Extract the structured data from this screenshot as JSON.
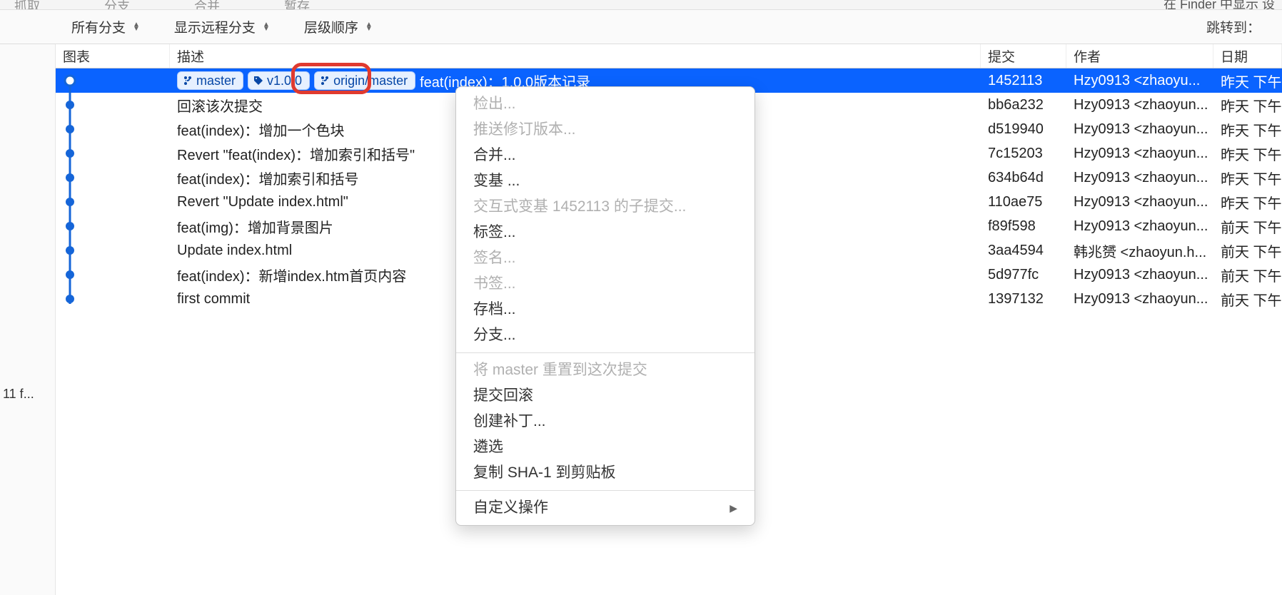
{
  "top_toolbar": {
    "items": [
      "抓取",
      "分支",
      "合并",
      "暂存"
    ],
    "right": "在 Finder 中显示   设"
  },
  "filter_bar": {
    "all_branches": "所有分支",
    "show_remote": "显示远程分支",
    "order": "层级顺序",
    "jump_to": "跳转到："
  },
  "columns": {
    "graph": "图表",
    "description": "描述",
    "commit": "提交",
    "author": "作者",
    "date": "日期"
  },
  "pills": {
    "master": "master",
    "tag": "v1.0.0",
    "origin_master": "origin/master"
  },
  "rows": [
    {
      "desc": "feat(index)：1.0.0版本记录",
      "commit": "1452113",
      "author": "Hzy0913 <zhaoyu...",
      "date": "昨天 下午",
      "selected": true,
      "has_pills": true
    },
    {
      "desc": "回滚该次提交",
      "commit": "bb6a232",
      "author": "Hzy0913 <zhaoyun...",
      "date": "昨天 下午"
    },
    {
      "desc": "feat(index)：增加一个色块",
      "commit": "d519940",
      "author": "Hzy0913 <zhaoyun...",
      "date": "昨天 下午"
    },
    {
      "desc": "Revert \"feat(index)：增加索引和括号\"",
      "commit": "7c15203",
      "author": "Hzy0913 <zhaoyun...",
      "date": "昨天 下午"
    },
    {
      "desc": "feat(index)：增加索引和括号",
      "commit": "634b64d",
      "author": "Hzy0913 <zhaoyun...",
      "date": "昨天 下午"
    },
    {
      "desc": "Revert \"Update index.html\"",
      "commit": "110ae75",
      "author": "Hzy0913 <zhaoyun...",
      "date": "昨天 下午"
    },
    {
      "desc": "feat(img)：增加背景图片",
      "commit": "f89f598",
      "author": "Hzy0913 <zhaoyun...",
      "date": "前天 下午"
    },
    {
      "desc": "Update index.html",
      "commit": "3aa4594",
      "author": "韩兆赟 <zhaoyun.h...",
      "date": "前天 下午"
    },
    {
      "desc": "feat(index)：新增index.htm首页内容",
      "commit": "5d977fc",
      "author": "Hzy0913 <zhaoyun...",
      "date": "前天 下午"
    },
    {
      "desc": "first commit",
      "commit": "1397132",
      "author": "Hzy0913 <zhaoyun...",
      "date": "前天 下午"
    }
  ],
  "sidebar": {
    "item": "11 f..."
  },
  "context_menu": {
    "items": [
      {
        "label": "检出...",
        "disabled": true
      },
      {
        "label": "推送修订版本...",
        "disabled": true
      },
      {
        "label": "合并...",
        "disabled": false
      },
      {
        "label": "变基 ...",
        "disabled": false
      },
      {
        "label": "交互式变基 1452113 的子提交...",
        "disabled": true
      },
      {
        "label": "标签...",
        "disabled": false,
        "highlight": true
      },
      {
        "label": "签名...",
        "disabled": true
      },
      {
        "label": "书签...",
        "disabled": true
      },
      {
        "label": "存档...",
        "disabled": false
      },
      {
        "label": "分支...",
        "disabled": false
      },
      {
        "sep": true
      },
      {
        "label": "将 master 重置到这次提交",
        "disabled": true
      },
      {
        "label": "提交回滚",
        "disabled": false
      },
      {
        "label": "创建补丁...",
        "disabled": false
      },
      {
        "label": "遴选",
        "disabled": false
      },
      {
        "label": "复制 SHA-1 到剪贴板",
        "disabled": false
      },
      {
        "sep": true
      },
      {
        "label": "自定义操作",
        "disabled": false,
        "submenu": true
      }
    ]
  }
}
